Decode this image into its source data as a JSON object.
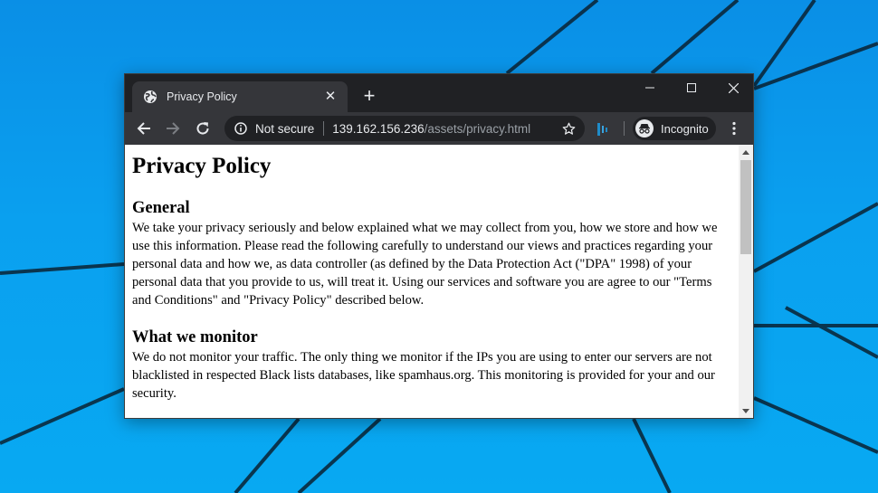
{
  "browser": {
    "tab_title": "Privacy Policy",
    "tab_close": "✕",
    "new_tab": "+",
    "security_label": "Not secure",
    "url_host": "139.162.156.236",
    "url_path": "/assets/privacy.html",
    "profile_label": "Incognito",
    "icons": {
      "tab": "globe-icon",
      "back": "arrow-left-icon",
      "forward": "arrow-right-icon",
      "reload": "reload-icon",
      "info": "info-icon",
      "bookmark": "star-icon",
      "extension": "extension-icon",
      "incognito": "incognito-icon",
      "menu": "kebab-menu-icon",
      "minimize": "minimize-icon",
      "maximize": "maximize-icon",
      "close": "close-icon"
    }
  },
  "page": {
    "title": "Privacy Policy",
    "sections": [
      {
        "heading": "General",
        "body": "We take your privacy seriously and below explained what we may collect from you, how we store and how we use this information. Please read the following carefully to understand our views and practices regarding your personal data and how we, as data controller (as defined by the Data Protection Act (\"DPA\" 1998) of your personal data that you provide to us, will treat it. Using our services and software you are agree to our \"Terms and Conditions\" and \"Privacy Policy\" described below."
      },
      {
        "heading": "What we monitor",
        "body": "We do not monitor your traffic. The only thing we monitor if the IPs you are using to enter our servers are not blacklisted in respected Black lists databases, like spamhaus.org. This monitoring is provided for your and our security."
      }
    ]
  },
  "colors": {
    "titlebar": "#202124",
    "toolbar": "#35363a",
    "text_light": "#e8eaed",
    "url_path": "#9aa0a6",
    "desktop": "#0aa0ef"
  }
}
